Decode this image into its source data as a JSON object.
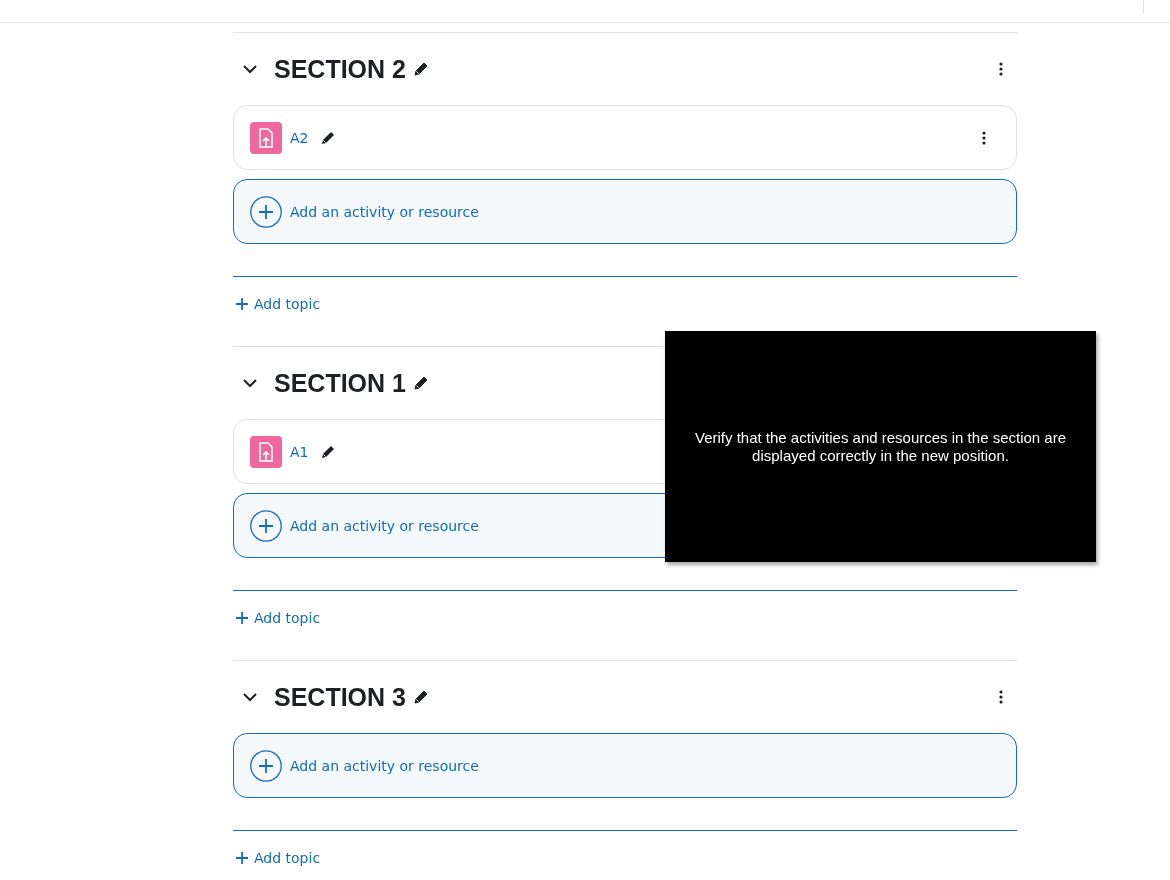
{
  "sections": [
    {
      "title": "SECTION 2",
      "activities": [
        {
          "name": "A2"
        }
      ],
      "add_activity": "Add an activity or resource",
      "add_topic": "Add topic"
    },
    {
      "title": "SECTION 1",
      "activities": [
        {
          "name": "A1"
        }
      ],
      "add_activity": "Add an activity or resource",
      "add_topic": "Add topic"
    },
    {
      "title": "SECTION 3",
      "add_activity": "Add an activity or resource",
      "add_topic": "Add topic"
    }
  ],
  "overlay": {
    "text": "Verify that the activities and resources in the section are displayed correctly in the new position."
  }
}
